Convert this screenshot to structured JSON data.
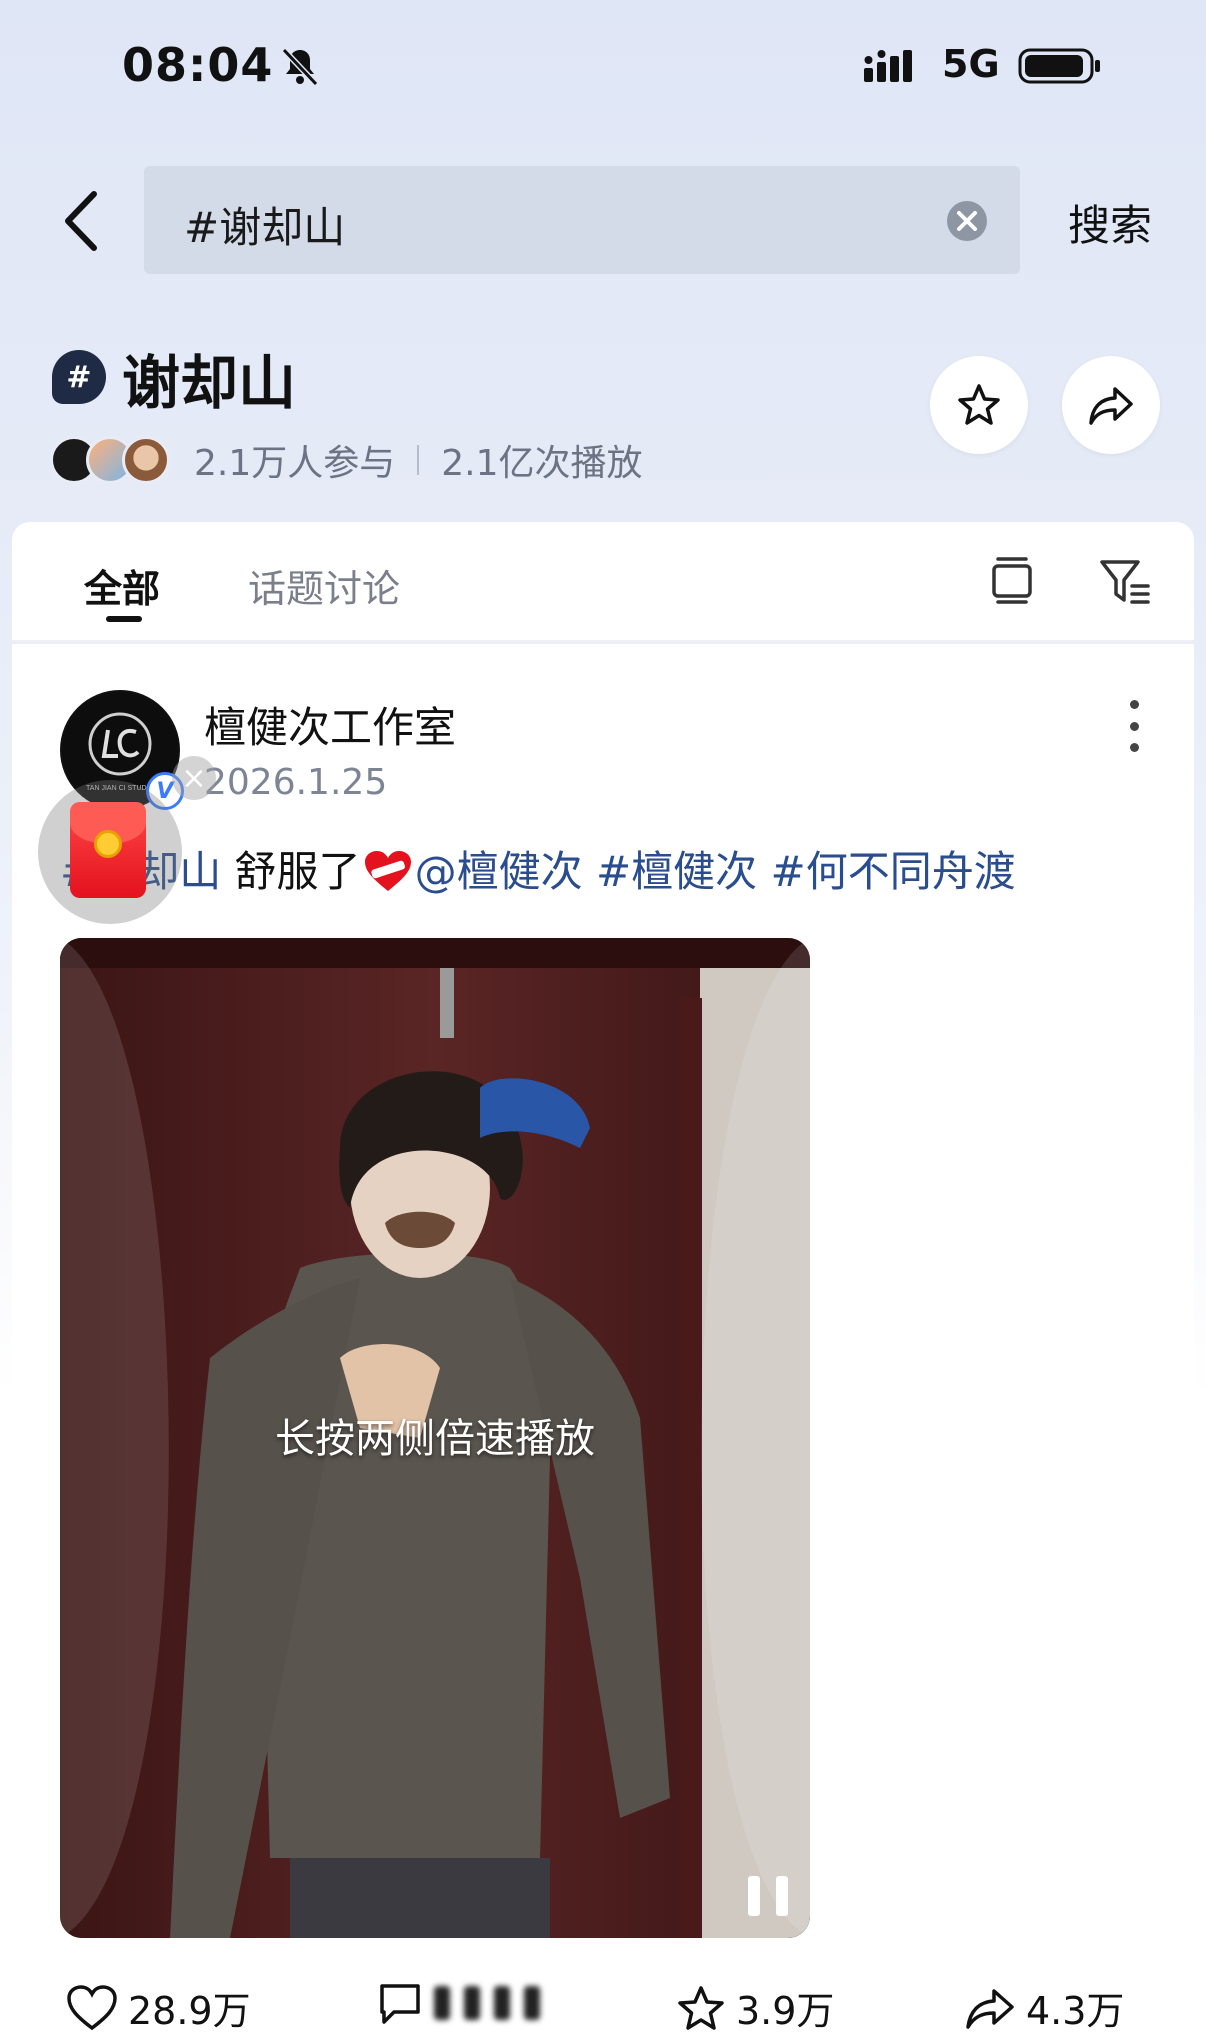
{
  "status_bar": {
    "time": "08:04",
    "network": "5G"
  },
  "search": {
    "query": "#谢却山",
    "button_label": "搜索"
  },
  "topic": {
    "title": "谢却山",
    "hash_symbol": "#",
    "participants": "2.1万人参与",
    "plays": "2.1亿次播放"
  },
  "tabs": [
    {
      "label": "全部",
      "active": true
    },
    {
      "label": "话题讨论",
      "active": false
    }
  ],
  "post": {
    "author": "檀健次工作室",
    "date": "2026.1.25",
    "text_parts": {
      "hashtag1": "#谢却山",
      "plain": " 舒服了",
      "mention": "@檀健次",
      "hashtag2": "#檀健次",
      "hashtag3": "#何不同舟渡"
    },
    "video_hint": "长按两侧倍速播放",
    "avatar_logo_text": "TAN JIAN CI STUDIO"
  },
  "actions": {
    "likes": "28.9万",
    "favorites": "3.9万",
    "shares": "4.3万"
  },
  "colors": {
    "link": "#2a4d8f",
    "accent_red": "#e3121e",
    "verified": "#3a7bff"
  }
}
